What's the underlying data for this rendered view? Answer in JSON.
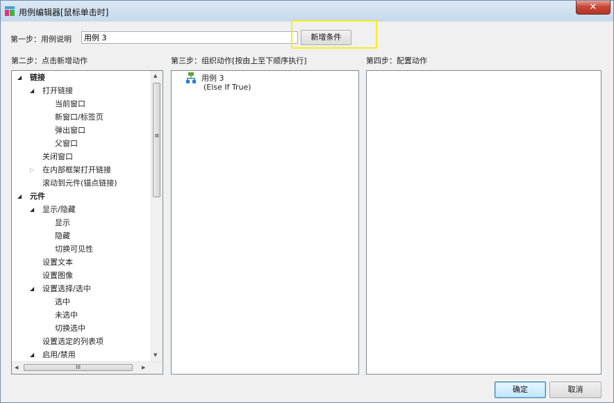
{
  "window": {
    "title": "用例编辑器[鼠标单击时]",
    "close_glyph": "✕"
  },
  "step1": {
    "label": "第一步：用例说明",
    "case_name_value": "用例 3",
    "add_condition_label": "新增条件"
  },
  "step2": {
    "label": "第二步：点击新增动作",
    "tree": [
      {
        "text": "链接",
        "level": 0,
        "expand": "open",
        "bold": true
      },
      {
        "text": "打开链接",
        "level": 1,
        "expand": "open"
      },
      {
        "text": "当前窗口",
        "level": 2
      },
      {
        "text": "新窗口/标签页",
        "level": 2
      },
      {
        "text": "弹出窗口",
        "level": 2
      },
      {
        "text": "父窗口",
        "level": 2
      },
      {
        "text": "关闭窗口",
        "level": 1
      },
      {
        "text": "在内部框架打开链接",
        "level": 1,
        "expand": "closed"
      },
      {
        "text": "滚动到元件(锚点链接)",
        "level": 1
      },
      {
        "text": "元件",
        "level": 0,
        "expand": "open",
        "bold": true
      },
      {
        "text": "显示/隐藏",
        "level": 1,
        "expand": "open"
      },
      {
        "text": "显示",
        "level": 2
      },
      {
        "text": "隐藏",
        "level": 2
      },
      {
        "text": "切换可见性",
        "level": 2
      },
      {
        "text": "设置文本",
        "level": 1
      },
      {
        "text": "设置图像",
        "level": 1
      },
      {
        "text": "设置选择/选中",
        "level": 1,
        "expand": "open"
      },
      {
        "text": "选中",
        "level": 2
      },
      {
        "text": "未选中",
        "level": 2
      },
      {
        "text": "切换选中",
        "level": 2
      },
      {
        "text": "设置选定的列表项",
        "level": 1
      },
      {
        "text": "启用/禁用",
        "level": 1,
        "expand": "open"
      }
    ]
  },
  "step3": {
    "label": "第三步：组织动作[按由上至下顺序执行]",
    "case_name": "用例 3",
    "case_condition": "(Else If True)"
  },
  "step4": {
    "label": "第四步：配置动作"
  },
  "footer": {
    "ok_label": "确定",
    "cancel_label": "取消"
  },
  "colors": {
    "highlight": "#f4ee1f",
    "case_icon_green": "#5aa53c",
    "case_icon_blue": "#2a7fd0"
  },
  "icons": {
    "expanded": "◢",
    "collapsed": "▷",
    "scroll_up": "▲",
    "scroll_down": "▼",
    "scroll_left": "◀",
    "scroll_right": "▶",
    "grip_v": "≡",
    "grip_h": "III"
  }
}
